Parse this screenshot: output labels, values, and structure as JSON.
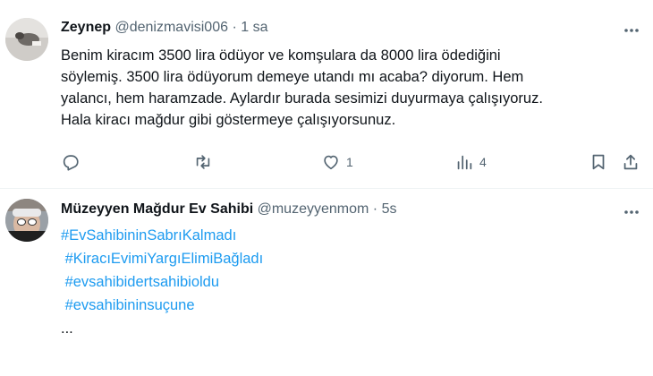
{
  "tweet1": {
    "name": "Zeynep",
    "handle": "@denizmavisi006",
    "separator": "·",
    "time": "1 sa",
    "lines": [
      "Benim kiracım 3500 lira ödüyor ve komşulara da 8000 lira ödediğini",
      "söylemiş. 3500 lira ödüyorum demeye utandı mı acaba? diyorum. Hem",
      "yalancı, hem haramzade. Aylardır burada sesimizi duyurmaya çalışıyoruz.",
      "Hala kiracı mağdur gibi göstermeye çalışıyorsunuz."
    ],
    "actions": {
      "reply_count": "",
      "retweet_count": "",
      "like_count": "1",
      "views_count": "4"
    },
    "icons": [
      "more-icon",
      "reply-icon",
      "retweet-icon",
      "like-icon",
      "views-icon",
      "bookmark-icon",
      "share-icon"
    ]
  },
  "tweet2": {
    "name": "Müzeyyen Mağdur Ev Sahibi",
    "handle": "@muzeyyenmom",
    "separator": "·",
    "time": "5s",
    "hashtags": [
      "#EvSahibininSabrıKalmadı",
      " #KiracıEvimiYargıElimiBağladı",
      " #evsahibidertsahibioldu",
      " #evsahibininsuçune"
    ],
    "ellipsis": "..."
  },
  "colors": {
    "text": "#0f1419",
    "meta": "#536471",
    "link": "#1d9bf0",
    "divider": "#eff3f4"
  }
}
